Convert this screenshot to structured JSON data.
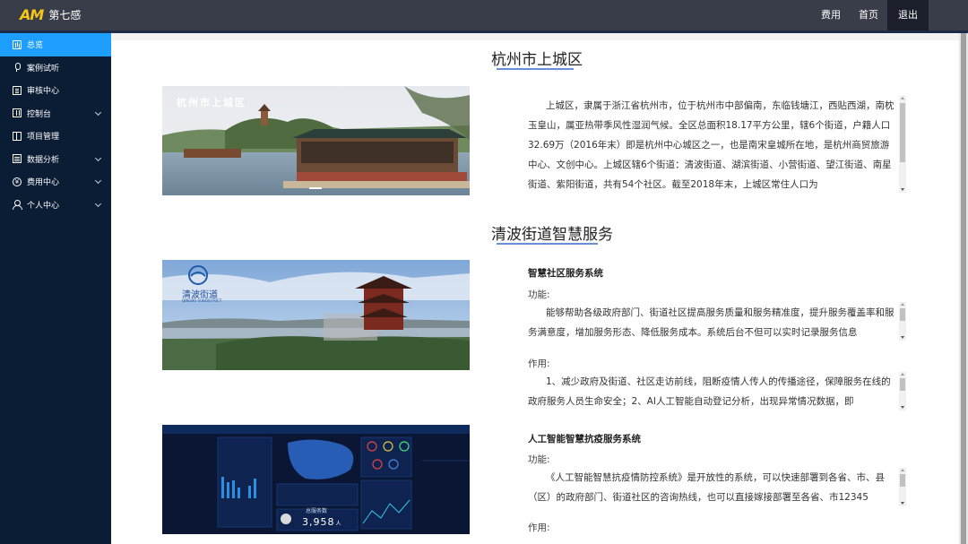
{
  "header": {
    "logo_mark": "AM",
    "logo_text": "第七感",
    "nav": [
      {
        "label": "费用"
      },
      {
        "label": "首页"
      },
      {
        "label": "退出"
      }
    ]
  },
  "sidebar": {
    "items": [
      {
        "label": "总览",
        "icon": "dashboard-icon",
        "active": true
      },
      {
        "label": "案例试听",
        "icon": "microphone-icon"
      },
      {
        "label": "审核中心",
        "icon": "document-icon"
      },
      {
        "label": "控制台",
        "icon": "grid-icon",
        "has_children": true
      },
      {
        "label": "项目管理",
        "icon": "book-icon"
      },
      {
        "label": "数据分析",
        "icon": "list-icon",
        "has_children": true
      },
      {
        "label": "费用中心",
        "icon": "yen-icon",
        "yen": "¥",
        "has_children": true
      },
      {
        "label": "个人中心",
        "icon": "user-icon",
        "has_children": true
      }
    ]
  },
  "sections": {
    "district": {
      "title": "杭州市上城区",
      "image_caption": "杭州市上城区",
      "text": "上城区，隶属于浙江省杭州市，位于杭州市中部偏南，东临钱塘江，西贴西湖，南枕玉皇山，属亚热带季风性湿润气候。全区总面积18.17平方公里，辖6个街道，户籍人口32.69万（2016年末）即是杭州中心城区之一，也是南宋皇城所在地，是杭州商贸旅游中心、文创中心。上城区辖6个街道：清波街道、湖滨街道、小营街道、望江街道、南星街道、紫阳街道，共有54个社区。截至2018年末，上城区常住人口为"
    },
    "service": {
      "title": "清波街道智慧服务",
      "image_caption": "清波街道",
      "image_caption_en": "QINGBO SUBDISTRICT",
      "systems": [
        {
          "name": "智慧社区服务系统",
          "func_label": "功能:",
          "func_text": "能够帮助各级政府部门、街道社区提高服务质量和服务精准度，提升服务覆盖率和服务满意度，增加服务形态、降低服务成本。系统后台不但可以实时记录服务信息",
          "use_label": "作用:",
          "use_text": "1、减少政府及街道、社区走访前线，阻断疫情人传人的传播途径，保障服务在线的政府服务人员生命安全；2、AI人工智能自动登记分析，出现异常情况数据，即"
        },
        {
          "name": "人工智能智慧抗疫服务系统",
          "func_label": "功能:",
          "func_text": "《人工智能智慧抗疫情防控系统》是开放性的系统，可以快速部署到各省、市、县（区）的政府部门、街道社区的咨询热线，也可以直接嫁接部署至各省、市12345",
          "use_label": "作用:",
          "dashboard_total_label": "总服务数",
          "dashboard_total_value": "3,958",
          "dashboard_unit": "人"
        }
      ]
    }
  }
}
